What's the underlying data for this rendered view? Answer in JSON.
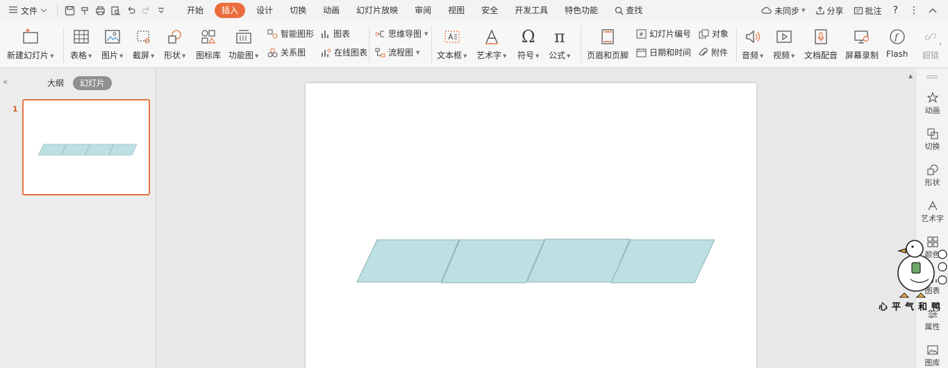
{
  "menubar": {
    "file_label": "文件",
    "tabs": [
      {
        "label": "开始"
      },
      {
        "label": "插入",
        "active": true
      },
      {
        "label": "设计"
      },
      {
        "label": "切换"
      },
      {
        "label": "动画"
      },
      {
        "label": "幻灯片放映"
      },
      {
        "label": "审阅"
      },
      {
        "label": "视图"
      },
      {
        "label": "安全"
      },
      {
        "label": "开发工具"
      },
      {
        "label": "特色功能"
      }
    ],
    "search_label": "查找",
    "sync_label": "未同步",
    "share_label": "分享",
    "comment_label": "批注",
    "help_label": "?"
  },
  "ribbon": {
    "new_slide": "新建幻灯片",
    "table": "表格",
    "picture": "图片",
    "screenshot": "截屏",
    "shape": "形状",
    "icon_lib": "图标库",
    "function_chart": "功能图",
    "smart_art": "智能图形",
    "chart": "图表",
    "relation": "关系图",
    "online_chart": "在线图表",
    "mind_map": "思维导图",
    "flowchart": "流程图",
    "text_box": "文本框",
    "word_art": "艺术字",
    "symbol": "符号",
    "formula": "公式",
    "header_footer": "页眉和页脚",
    "slide_number": "幻灯片编号",
    "object": "对象",
    "date_time": "日期和时间",
    "attachment": "附件",
    "audio": "音频",
    "video": "视频",
    "doc_dub": "文档配音",
    "screen_record": "屏幕录制",
    "flash": "Flash",
    "hyperlink": "超链"
  },
  "leftpanel": {
    "outline_tab": "大纲",
    "slides_tab": "幻灯片",
    "slide_number": "1"
  },
  "rightpanel": {
    "items": [
      {
        "label": "动画"
      },
      {
        "label": "切换"
      },
      {
        "label": "形状"
      },
      {
        "label": "艺术字"
      },
      {
        "label": "颜色"
      },
      {
        "label": "图表"
      },
      {
        "label": "属性"
      },
      {
        "label": "图库"
      }
    ]
  },
  "sticker": {
    "text": "心平气和鸭"
  },
  "colors": {
    "accent": "#ea6d3d",
    "shape_fill": "#bde0e3",
    "shape_stroke": "#8fb0b3"
  }
}
